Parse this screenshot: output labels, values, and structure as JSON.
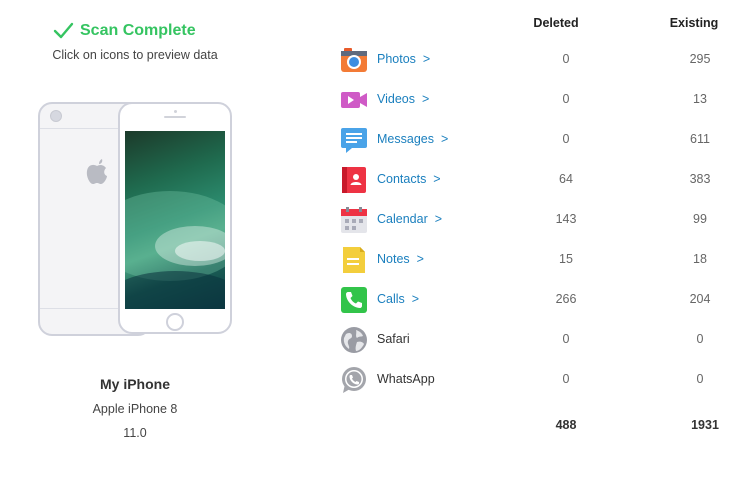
{
  "scan": {
    "title": "Scan Complete",
    "hint": "Click on icons to preview data",
    "color": "#35c461"
  },
  "device": {
    "name": "My iPhone",
    "model": "Apple iPhone 8",
    "os": "11.0"
  },
  "columns": {
    "deleted": "Deleted",
    "existing": "Existing"
  },
  "categories": [
    {
      "label": "Photos",
      "arrow": ">",
      "deleted": "0",
      "existing": "295",
      "icon": "camera-icon",
      "color": "#f37b36",
      "link": true
    },
    {
      "label": "Videos",
      "arrow": ">",
      "deleted": "0",
      "existing": "13",
      "icon": "video-camera-icon",
      "color": "#cf5ac6",
      "link": true
    },
    {
      "label": "Messages",
      "arrow": ">",
      "deleted": "0",
      "existing": "611",
      "icon": "message-icon",
      "color": "#4aa3e8",
      "link": true
    },
    {
      "label": "Contacts",
      "arrow": ">",
      "deleted": "64",
      "existing": "383",
      "icon": "contacts-book-icon",
      "color": "#ee3344",
      "link": true
    },
    {
      "label": "Calendar",
      "arrow": ">",
      "deleted": "143",
      "existing": "99",
      "icon": "calendar-icon",
      "color": "#a9abb8",
      "link": true
    },
    {
      "label": "Notes",
      "arrow": ">",
      "deleted": "15",
      "existing": "18",
      "icon": "notes-icon",
      "color": "#f3ce3c",
      "link": true
    },
    {
      "label": "Calls",
      "arrow": ">",
      "deleted": "266",
      "existing": "204",
      "icon": "phone-icon",
      "color": "#32c44a",
      "link": true
    },
    {
      "label": "Safari",
      "arrow": "",
      "deleted": "0",
      "existing": "0",
      "icon": "globe-icon",
      "color": "#9a9ca4",
      "link": false
    },
    {
      "label": "WhatsApp",
      "arrow": "",
      "deleted": "0",
      "existing": "0",
      "icon": "whatsapp-icon",
      "color": "#a3a5ab",
      "link": false
    }
  ],
  "totals": {
    "deleted": "488",
    "existing": "1931"
  }
}
